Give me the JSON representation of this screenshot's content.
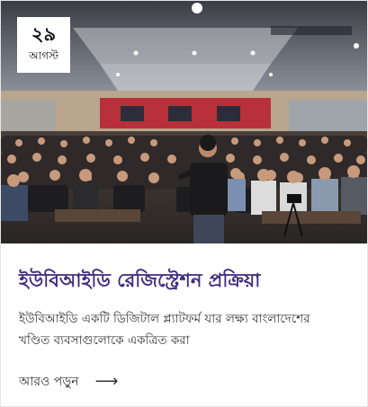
{
  "card": {
    "date": {
      "day": "২৯",
      "month": "আগস্ট"
    },
    "image": {
      "icon": "event-photo"
    },
    "title": "ইউবিআইডি রেজিস্ট্রেশন প্রক্রিয়া",
    "description": "ইউবিআইডি একটি ডিজিটাল প্ল্যাটফর্ম যার লক্ষ্য বাংলাদেশের খণ্ডিত ব্যবসাগুলোকে একত্রিত করা",
    "read_more": {
      "label": "আরও পড়ুন",
      "icon": "arrow-right-icon"
    },
    "colors": {
      "title": "#3f2d7e",
      "text": "#333333",
      "border": "#e6e6e6"
    }
  }
}
